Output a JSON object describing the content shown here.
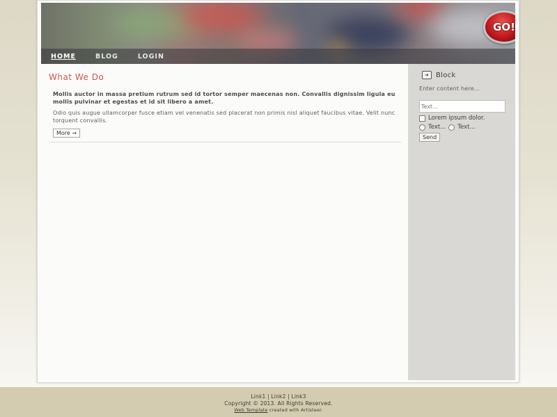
{
  "header": {
    "logo_text": "GO!",
    "nav": [
      {
        "label": "HOME",
        "active": true
      },
      {
        "label": "BLOG",
        "active": false
      },
      {
        "label": "LOGIN",
        "active": false
      }
    ]
  },
  "main": {
    "title": "What We Do",
    "lead": "Mollis auctor in massa pretium rutrum sed id tortor semper maecenas non. Convallis dignissim ligula eu mollis pulvinar et egestas et id sit libero a amet.",
    "body": "Odio quis augue ullamcorper fusce etiam vel venenatis sed placerat non primis nisl aliquet faucibus vitae. Velit nunc torquent convallis.",
    "more_label": "More →"
  },
  "sidebar": {
    "block_title": "Block",
    "block_icon": "arrow-right-icon",
    "content_text": "Enter content here...",
    "input_placeholder": "Text...",
    "checkbox_label": "Lorem ipsum dolor.",
    "radio1_label": "Text...",
    "radio2_label": "Text...",
    "send_label": "Send"
  },
  "footer": {
    "link1": "Link1",
    "sep1": "|",
    "link2": "Link2",
    "sep2": "|",
    "link3": "Link3",
    "copyright": "Copyright © 2013. All Rights Reserved.",
    "credit_link": "Web Template",
    "credit_text": " created with Artisteer."
  },
  "colors": {
    "title_accent": "#c9584e",
    "sidebar_bg": "#d9d8d5",
    "footer_bg": "#d3ccb0",
    "logo_red": "#c3191d"
  }
}
